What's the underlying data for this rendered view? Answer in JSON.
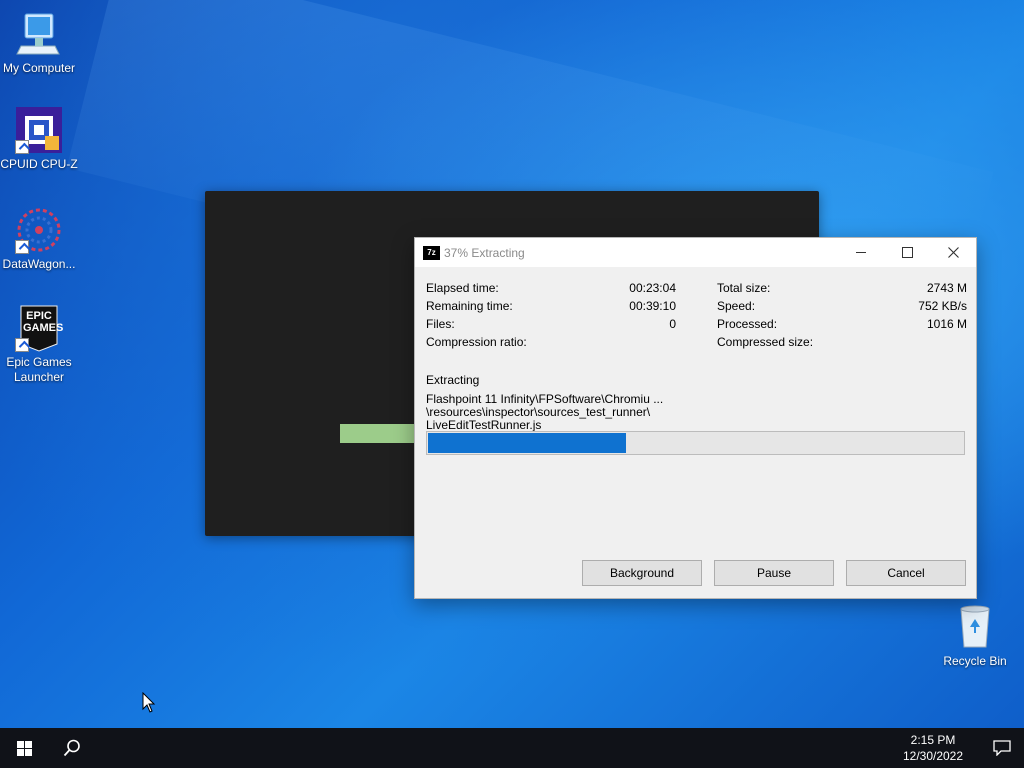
{
  "desktop": {
    "icons": [
      {
        "label": "My Computer",
        "icon": "computer-icon"
      },
      {
        "label": "CPUID CPU-Z",
        "icon": "cpuz-icon"
      },
      {
        "label": "DataWagon...",
        "icon": "datawagon-icon"
      },
      {
        "label": "Epic Games Launcher",
        "icon": "epic-games-icon",
        "logo_text": "EPIC GAMES"
      },
      {
        "label": "Recycle Bin",
        "icon": "recycle-bin-icon"
      }
    ]
  },
  "dialog": {
    "title": "37% Extracting",
    "app_icon_text": "7z",
    "left_stats": [
      {
        "label": "Elapsed time:",
        "value": "00:23:04"
      },
      {
        "label": "Remaining time:",
        "value": "00:39:10"
      },
      {
        "label": "Files:",
        "value": "0"
      },
      {
        "label": "Compression ratio:",
        "value": ""
      }
    ],
    "right_stats": [
      {
        "label": "Total size:",
        "value": "2743 M"
      },
      {
        "label": "Speed:",
        "value": "752 KB/s"
      },
      {
        "label": "Processed:",
        "value": "1016 M"
      },
      {
        "label": "Compressed size:",
        "value": ""
      }
    ],
    "status_label": "Extracting",
    "path_line1": "Flashpoint 11 Infinity\\FPSoftware\\Chromiu ... \\resources\\inspector\\sources_test_runner\\",
    "path_line2": "LiveEditTestRunner.js",
    "progress_percent": 37,
    "buttons": {
      "background": "Background",
      "pause": "Pause",
      "cancel": "Cancel"
    }
  },
  "taskbar": {
    "time": "2:15 PM",
    "date": "12/30/2022"
  },
  "colors": {
    "progress": "#0f72d0",
    "taskbar": "#101218",
    "dark_window": "#1f1f1f",
    "green_bar": "#9ccc8a"
  }
}
